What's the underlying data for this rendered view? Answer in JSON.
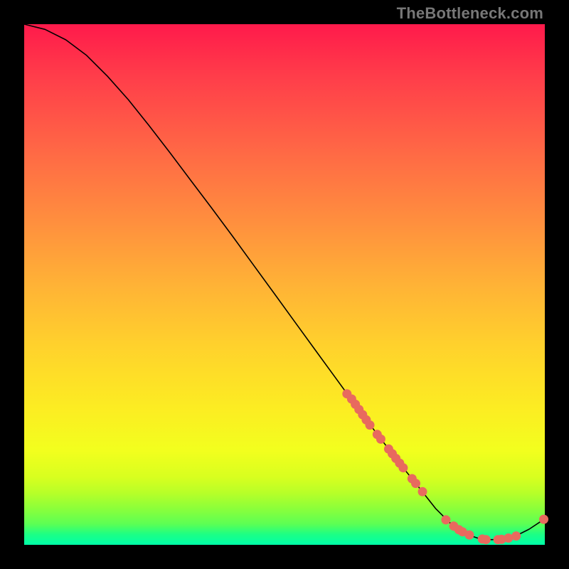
{
  "watermark": "TheBottleneck.com",
  "colors": {
    "dot": "#e86a5e",
    "line": "#000000"
  },
  "chart_data": {
    "type": "line",
    "title": "",
    "xlabel": "",
    "ylabel": "",
    "xlim": [
      0,
      100
    ],
    "ylim": [
      0,
      100
    ],
    "grid": false,
    "legend": false,
    "x": [
      0,
      4,
      8,
      12,
      16,
      20,
      24,
      28,
      32,
      36,
      40,
      44,
      48,
      52,
      56,
      60,
      64,
      68,
      72,
      76,
      79,
      82,
      85,
      88,
      91,
      94,
      97,
      100
    ],
    "values": [
      100,
      99,
      97,
      94,
      90,
      85.5,
      80.5,
      75.3,
      70,
      64.7,
      59.3,
      53.8,
      48.3,
      42.8,
      37.3,
      31.8,
      26.3,
      21,
      15.8,
      10.8,
      7,
      4,
      2,
      1,
      1,
      1.5,
      3,
      5
    ],
    "dots_x": [
      62,
      62.9,
      63.6,
      64.3,
      65,
      65.7,
      66.4,
      67.8,
      68.5,
      70,
      70.7,
      71.4,
      72.1,
      72.8,
      74.5,
      75.2,
      76.5,
      81,
      82.5,
      83.5,
      84.2,
      85.5,
      88,
      88.7,
      91,
      91.7,
      93,
      94.5,
      99.8
    ],
    "dots_y": [
      29,
      28,
      27,
      26,
      25,
      24,
      23,
      21.2,
      20.3,
      18.4,
      17.5,
      16.6,
      15.7,
      14.8,
      12.7,
      11.8,
      10.2,
      4.8,
      3.6,
      2.9,
      2.5,
      1.9,
      1.1,
      1,
      1,
      1.05,
      1.3,
      1.7,
      4.9
    ]
  }
}
